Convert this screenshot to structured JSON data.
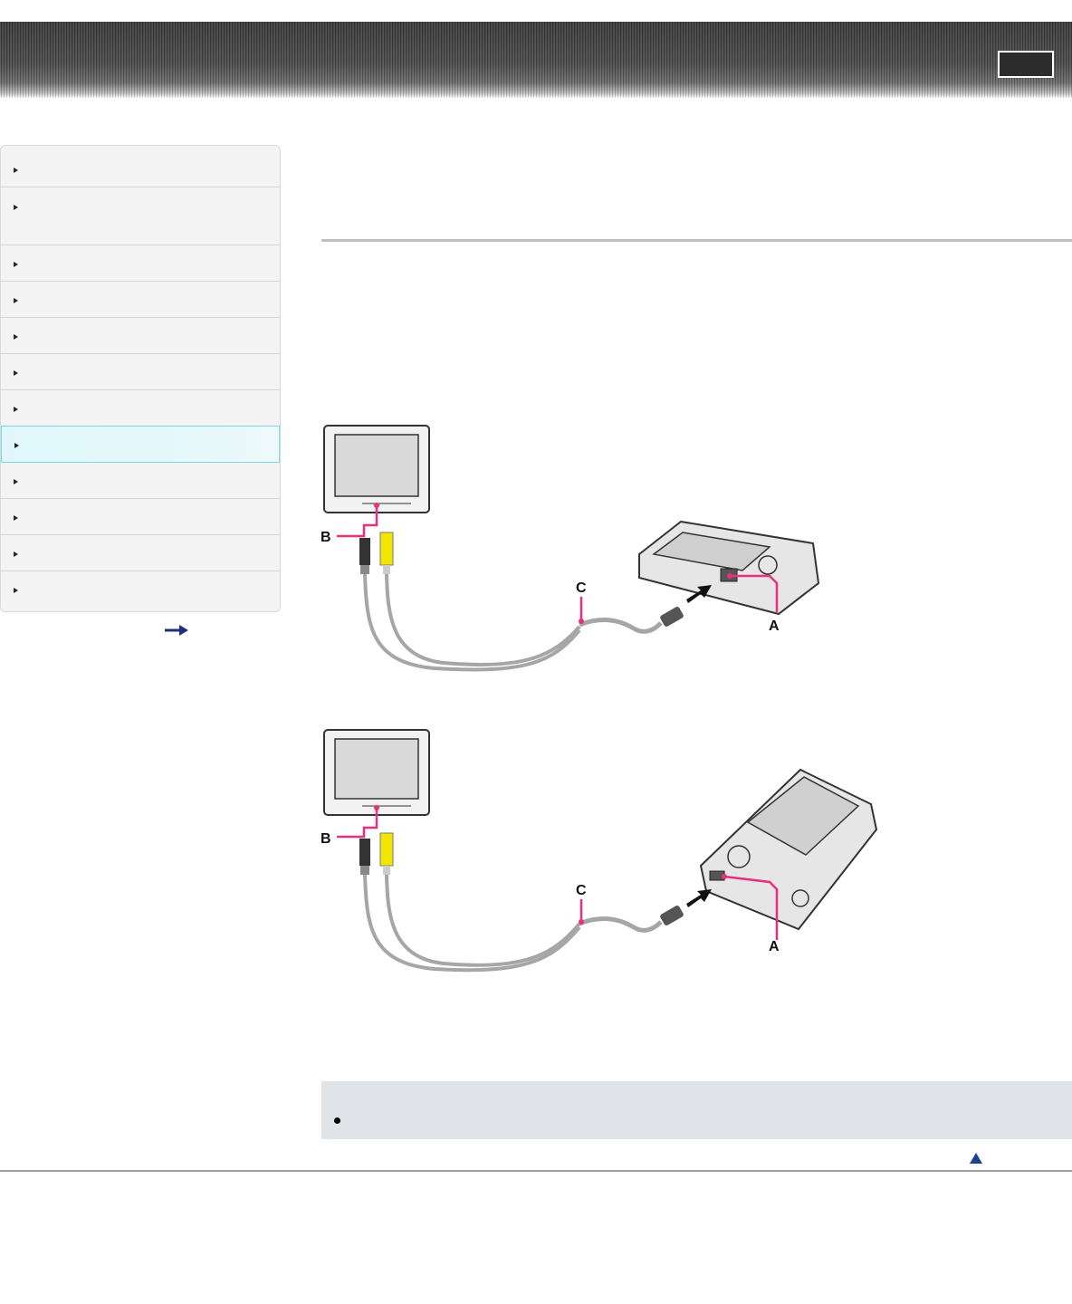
{
  "header": {
    "button_icon": "blank-button"
  },
  "sidebar": {
    "items": [
      {
        "icon": "arrow-right-icon"
      },
      {
        "icon": "arrow-right-icon"
      },
      {
        "icon": "arrow-right-icon"
      },
      {
        "icon": "arrow-right-icon"
      },
      {
        "icon": "arrow-right-icon"
      },
      {
        "icon": "arrow-right-icon"
      },
      {
        "icon": "arrow-right-icon"
      },
      {
        "icon": "arrow-right-icon",
        "active": true
      },
      {
        "icon": "arrow-right-icon"
      },
      {
        "icon": "arrow-right-icon"
      },
      {
        "icon": "arrow-right-icon"
      },
      {
        "icon": "arrow-right-icon"
      }
    ],
    "more_icon": "long-arrow-right-icon"
  },
  "diagrams": [
    {
      "labels": {
        "a": "A",
        "b": "B",
        "c": "C"
      }
    },
    {
      "labels": {
        "a": "A",
        "b": "B",
        "c": "C"
      }
    }
  ],
  "note": {
    "bullet_icon": "bullet-icon"
  },
  "page_top_icon": "triangle-up-icon",
  "colors": {
    "accent_pink": "#e8307c",
    "active_nav": "#dff7fb",
    "note_bg": "#e0e3e8",
    "cable_yellow": "#f2e600"
  }
}
